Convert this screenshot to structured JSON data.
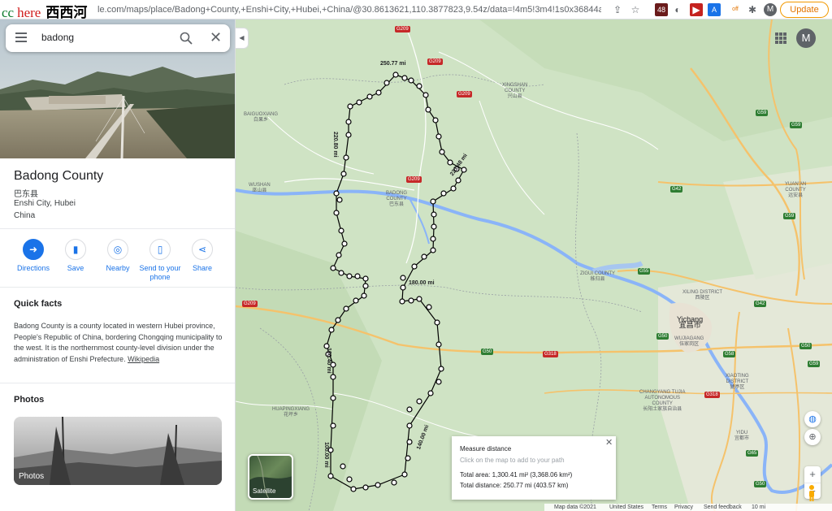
{
  "watermark": {
    "latin": "cc",
    "red": "here",
    "cn": "西西河"
  },
  "browser": {
    "url": "le.com/maps/place/Badong+County,+Enshi+City,+Hubei,+China/@30.8613621,110.3877823,9.54z/data=!4m5!3m4!1s0x36844a401fbf29a3:...",
    "ext_badge": "48",
    "ext_off": "off",
    "profile": "M",
    "update_label": "Update"
  },
  "search": {
    "value": "badong",
    "placeholder": "Search Google Maps"
  },
  "place": {
    "title": "Badong County",
    "cn_name": "巴东县",
    "city": "Enshi City, Hubei",
    "country": "China"
  },
  "actions": [
    {
      "label": "Directions",
      "icon": "directions-icon",
      "symbol": "➜"
    },
    {
      "label": "Save",
      "icon": "bookmark-icon",
      "symbol": "🔖"
    },
    {
      "label": "Nearby",
      "icon": "nearby-icon",
      "symbol": "◎"
    },
    {
      "label": "Send to your phone",
      "icon": "send-to-phone-icon",
      "symbol": "▯"
    },
    {
      "label": "Share",
      "icon": "share-icon",
      "symbol": "⋖"
    }
  ],
  "quick_facts": {
    "title": "Quick facts",
    "text": "Badong County is a county located in western Hubei province, People's Republic of China, bordering Chongqing municipality to the west. It is the northernmost county-level division under the administration of Enshi Prefecture.",
    "link": "Wikipedia"
  },
  "photos": {
    "title": "Photos",
    "label": "Photos"
  },
  "map": {
    "profile": "M",
    "places": [
      {
        "name": "XINGSHAN\nCOUNTY",
        "cn": "兴山县"
      },
      {
        "name": "BAIGUOXIANG",
        "cn": "白果乡"
      },
      {
        "name": "WUSHAN",
        "cn": "巫山县"
      },
      {
        "name": "BADONG\nCOUNTY",
        "cn": "巴东县"
      },
      {
        "name": "ZIGUI COUNTY",
        "cn": "秭归县"
      },
      {
        "name": "XILING DISTRICT",
        "cn": "西陵区"
      },
      {
        "name": "Yichang",
        "cn": "宜昌市"
      },
      {
        "name": "WUJIAGANG",
        "cn": "伍家岗区"
      },
      {
        "name": "XIAOTING\nDISTRICT",
        "cn": "猇亭区"
      },
      {
        "name": "CHANGYANG TUJIA\nAUTONOMOUS\nCOUNTY",
        "cn": "长阳土家族自治县"
      },
      {
        "name": "HUAPINGXIANG",
        "cn": "花坪乡"
      },
      {
        "name": "YIDU",
        "cn": "宜都市"
      },
      {
        "name": "YUAN'AN\nCOUNTY",
        "cn": "远安县"
      }
    ],
    "shields": [
      "G209",
      "G209",
      "G209",
      "G209",
      "G209",
      "G59",
      "G59",
      "G59",
      "G42",
      "G42",
      "G55",
      "G50",
      "G50",
      "G318",
      "G318",
      "G58",
      "G50",
      "G65",
      "G50",
      "G59"
    ],
    "distance_labels": [
      "250.77 mi",
      "223.48 mi",
      "220.80 mi",
      "180.00 mi",
      "100.40 mi",
      "140.00 mi",
      "100.00 mi"
    ],
    "measure": {
      "title": "Measure distance",
      "hint": "Click on the map to add to your path",
      "area": "Total area: 1,300.41 mi² (3,368.06 km²)",
      "distance": "Total distance: 250.77 mi (403.57 km)"
    },
    "satellite_label": "Satellite",
    "footer": {
      "data": "Map data ©2021",
      "country": "United States",
      "terms": "Terms",
      "privacy": "Privacy",
      "feedback": "Send feedback",
      "scale": "10 mi"
    }
  }
}
